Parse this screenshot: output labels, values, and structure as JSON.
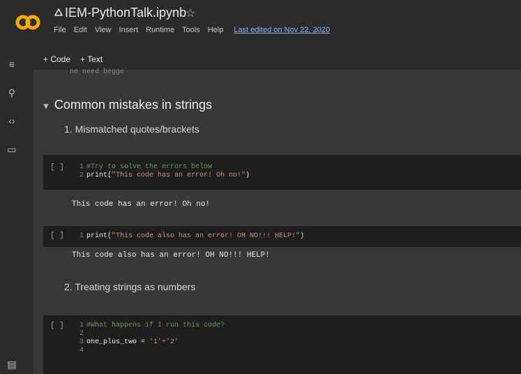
{
  "app": {
    "notebook_title": "IEM-PythonTalk.ipynb",
    "menu": [
      "File",
      "Edit",
      "View",
      "Insert",
      "Runtime",
      "Tools",
      "Help"
    ],
    "last_edited": "Last edited on Nov 22, 2020"
  },
  "toolbar": {
    "code_label": "+ Code",
    "text_label": "+ Text"
  },
  "peek_text": "ne need  begge",
  "section": {
    "heading": "Common mistakes in strings",
    "items": [
      "1. Mismatched quotes/brackets",
      "2. Treating strings as numbers"
    ]
  },
  "cells": [
    {
      "bracket": "[ ]",
      "lines": [
        {
          "n": "1",
          "comment": "#Try to solve the errors below"
        },
        {
          "n": "2",
          "fn": "print(",
          "str": "\"This code has an error! Oh no!\"",
          "end": ")"
        }
      ],
      "output": "This code has an error! Oh no!"
    },
    {
      "bracket": "[ ]",
      "lines": [
        {
          "n": "1",
          "fn": "print(",
          "str": "\"This code also has an error! OH NO!!! HELP!\"",
          "end": ")"
        }
      ],
      "output": "This code also has an error! OH NO!!! HELP!"
    },
    {
      "bracket": "[ ]",
      "lines": [
        {
          "n": "1",
          "comment": "#What happens if I run this code?"
        },
        {
          "n": "2"
        },
        {
          "n": "3",
          "fn": "one_plus_two = ",
          "str": "'1'+'2'"
        },
        {
          "n": "4"
        }
      ]
    }
  ],
  "icons": [
    "menu-icon",
    "search-icon",
    "code-icon",
    "folder-icon",
    "terminal-icon"
  ],
  "colors": {
    "comment": "#6a9955",
    "string": "#ce9178",
    "logo_orange": "#f9ab00",
    "link": "#8ab4f8"
  }
}
